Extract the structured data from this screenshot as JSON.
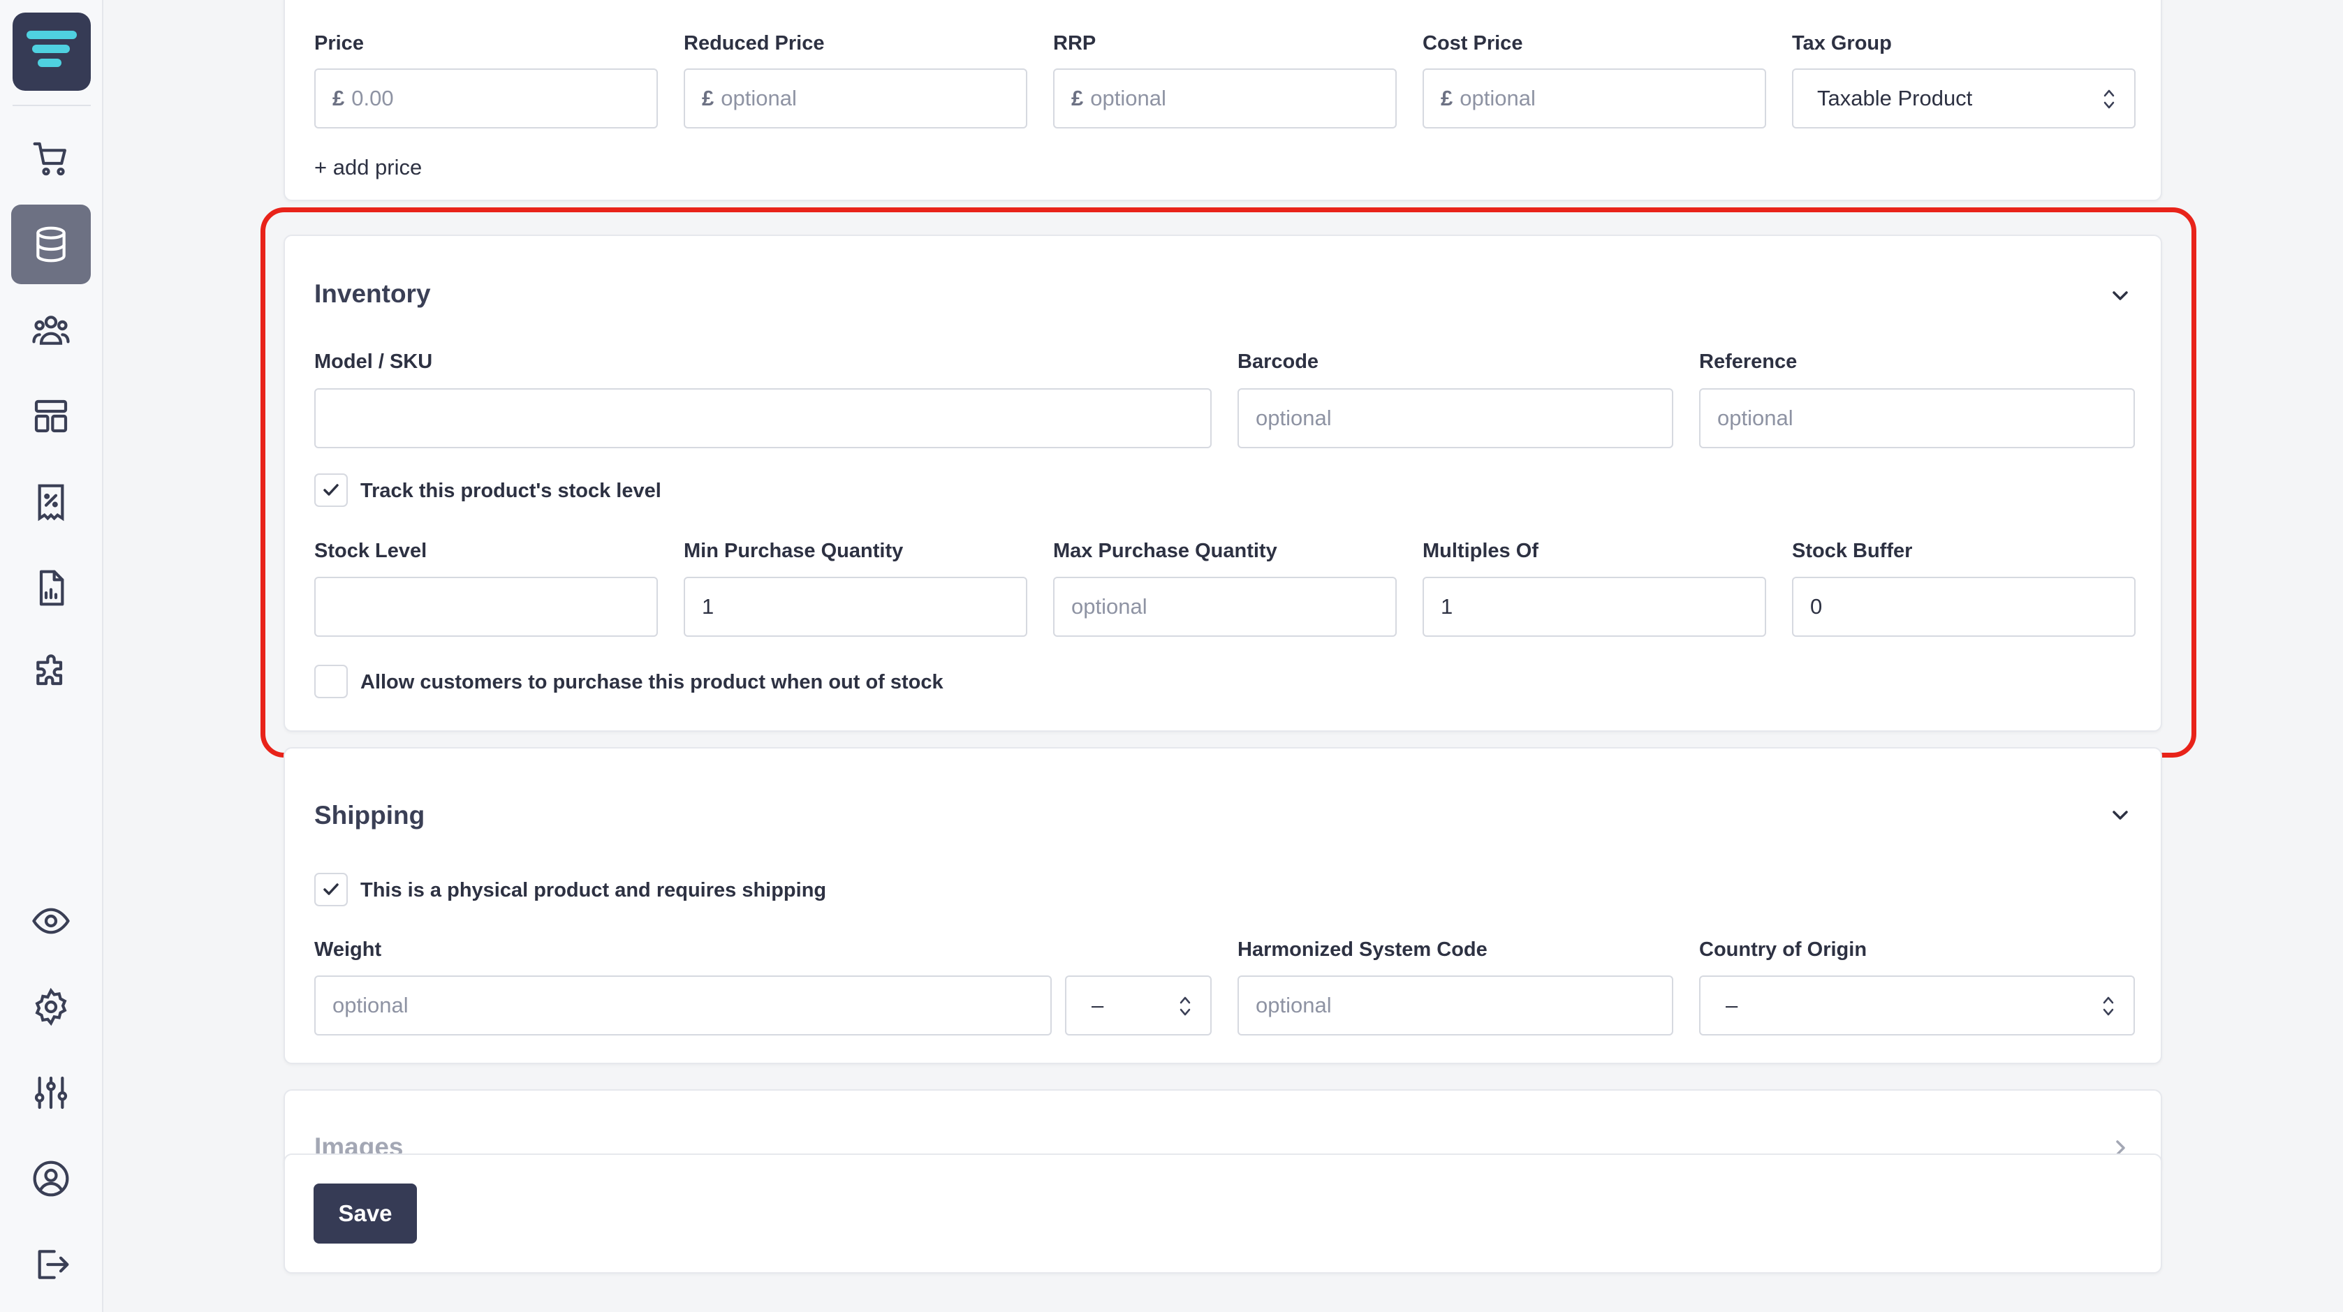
{
  "sidebar": {
    "items": [
      {
        "icon": "cart-icon",
        "active": false
      },
      {
        "icon": "database-icon",
        "active": true
      },
      {
        "icon": "users-icon",
        "active": false
      },
      {
        "icon": "layout-icon",
        "active": false
      },
      {
        "icon": "receipt-percent-icon",
        "active": false
      },
      {
        "icon": "report-icon",
        "active": false
      },
      {
        "icon": "puzzle-icon",
        "active": false
      },
      {
        "icon": "eye-icon",
        "active": false
      },
      {
        "icon": "gear-icon",
        "active": false
      },
      {
        "icon": "sliders-icon",
        "active": false
      },
      {
        "icon": "user-circle-icon",
        "active": false
      },
      {
        "icon": "logout-icon",
        "active": false
      }
    ]
  },
  "pricing": {
    "price_label": "Price",
    "price_currency": "£",
    "price_placeholder": "0.00",
    "reduced_label": "Reduced Price",
    "reduced_currency": "£",
    "reduced_placeholder": "optional",
    "rrp_label": "RRP",
    "rrp_currency": "£",
    "rrp_placeholder": "optional",
    "cost_label": "Cost Price",
    "cost_currency": "£",
    "cost_placeholder": "optional",
    "tax_label": "Tax Group",
    "tax_value": "Taxable Product",
    "add_price": "+ add price"
  },
  "inventory": {
    "title": "Inventory",
    "model_label": "Model / SKU",
    "model_value": "",
    "barcode_label": "Barcode",
    "barcode_placeholder": "optional",
    "reference_label": "Reference",
    "reference_placeholder": "optional",
    "track_label": "Track this product's stock level",
    "track_checked": true,
    "stock_level_label": "Stock Level",
    "stock_level_value": "",
    "min_label": "Min Purchase Quantity",
    "min_value": "1",
    "max_label": "Max Purchase Quantity",
    "max_placeholder": "optional",
    "multiples_label": "Multiples Of",
    "multiples_value": "1",
    "buffer_label": "Stock Buffer",
    "buffer_value": "0",
    "oos_label": "Allow customers to purchase this product when out of stock",
    "oos_checked": false
  },
  "shipping": {
    "title": "Shipping",
    "physical_label": "This is a physical product and requires shipping",
    "physical_checked": true,
    "weight_label": "Weight",
    "weight_placeholder": "optional",
    "weight_unit": "–",
    "hs_label": "Harmonized System Code",
    "hs_placeholder": "optional",
    "country_label": "Country of Origin",
    "country_value": "–"
  },
  "images": {
    "title": "Images"
  },
  "footer": {
    "save_label": "Save"
  },
  "colors": {
    "highlight": "#e8231a",
    "primary": "#363b55",
    "logo_accent": "#4fd1e0"
  }
}
